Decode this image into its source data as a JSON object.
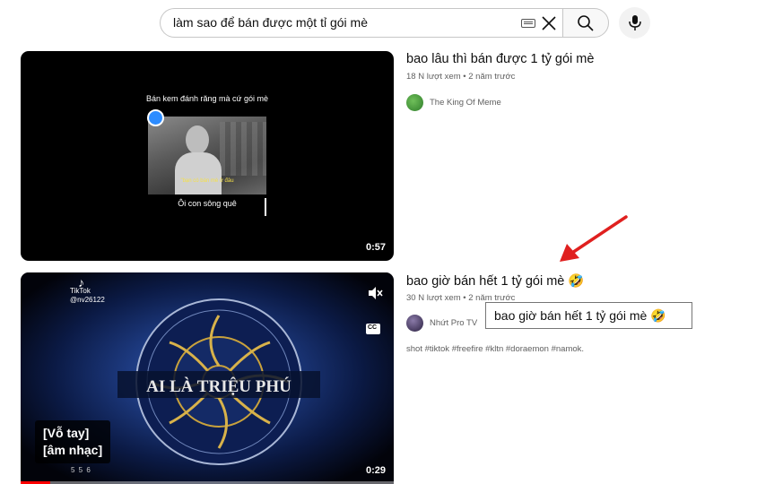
{
  "search": {
    "query": "làm sao để bán được một tỉ gói mè"
  },
  "videos": [
    {
      "title": "bao lâu thì bán được 1 tỷ gói mè",
      "views": "18 N lượt xem",
      "age": "2 năm trước",
      "channel": "The King Of Meme",
      "duration": "0:57",
      "thumb_caption_top": "Bán kem đánh răng mà cứ gói mè",
      "thumb_subtitle": "\"bạn có bán mè ở đâu",
      "thumb_caption_bottom": "Ôi con sông quê"
    },
    {
      "title": "bao giờ bán hết 1 tỷ gói mè 🤣",
      "views": "30 N lượt xem",
      "age": "2 năm trước",
      "channel": "Nhứt Pro TV",
      "duration": "0:29",
      "tags": "shot #tiktok #freefire #kltn #doraemon #namok.",
      "tiktok_label": "TikTok",
      "tiktok_user": "@nv26122",
      "logo_text": "AI LÀ TRIỆU PHÚ",
      "subtitle_line1": "[Vỗ tay]",
      "subtitle_line2": "[âm nhạc]",
      "overlay_number": "5 5 6"
    }
  ],
  "tooltip": {
    "text": "bao giờ bán hết 1 tỷ gói mè 🤣"
  },
  "colors": {
    "annotation_arrow": "#e0201f",
    "progress": "#ff0000"
  }
}
